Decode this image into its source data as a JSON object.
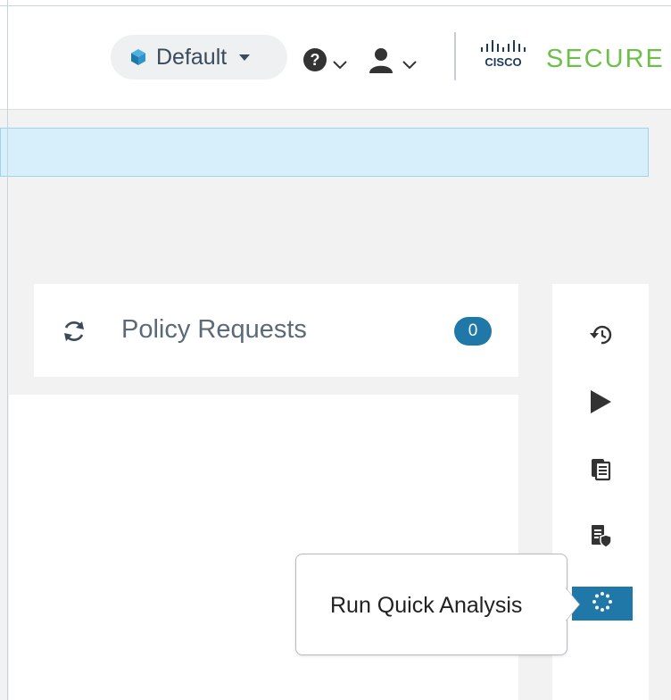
{
  "header": {
    "scope_selector": {
      "label": "Default"
    },
    "help_menu": {
      "icon": "question-circle-icon"
    },
    "user_menu": {
      "icon": "user-icon"
    },
    "brand": {
      "logo": "cisco-logo",
      "logo_text": "CISCO",
      "product": "SECURE",
      "color": "#6cc04a"
    }
  },
  "banner": {
    "color": "#d6effa"
  },
  "policy_requests": {
    "title": "Policy Requests",
    "count": "0",
    "icon": "refresh-icon",
    "badge_color": "#1f78a8"
  },
  "right_rail": {
    "items": [
      {
        "name": "history",
        "icon": "history-icon"
      },
      {
        "name": "run",
        "icon": "play-icon"
      },
      {
        "name": "clipboard",
        "icon": "clipboard-icon"
      },
      {
        "name": "policy-report",
        "icon": "document-shield-icon"
      },
      {
        "name": "quick-analysis",
        "icon": "spinner-dots-icon",
        "active": true
      }
    ],
    "accent": "#1f78a8"
  },
  "tooltip": {
    "text": "Run Quick Analysis"
  }
}
